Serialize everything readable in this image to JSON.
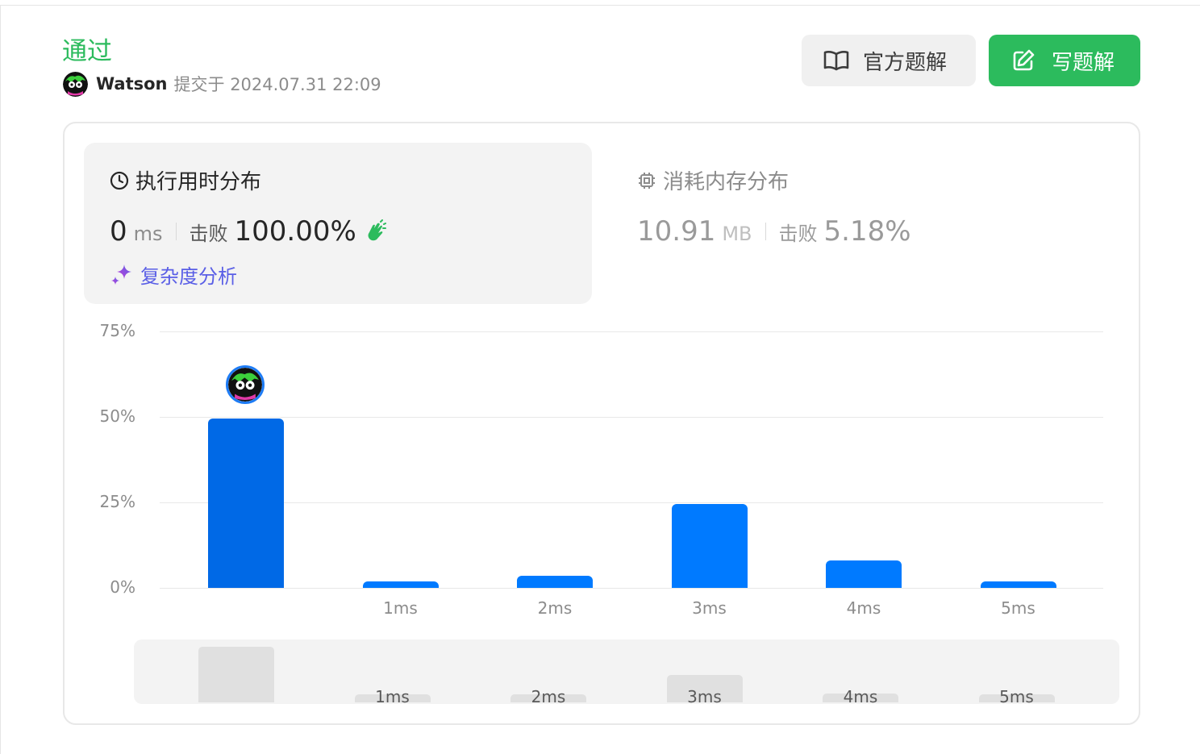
{
  "header": {
    "status": "通过",
    "user": "Watson",
    "submitted_label": "提交于 2024.07.31 22:09",
    "solution_button": "官方题解",
    "write_button": "写题解",
    "icons": [
      "book-icon",
      "edit-icon",
      "avatar"
    ]
  },
  "time_tab": {
    "title": "执行用时分布",
    "value": "0",
    "unit": "ms",
    "beat_label": "击败",
    "beat_value": "100.00%",
    "complexity_link": "复杂度分析"
  },
  "memory_tab": {
    "title": "消耗内存分布",
    "value": "10.91",
    "unit": "MB",
    "beat_label": "击败",
    "beat_value": "5.18%"
  },
  "colors": {
    "accent": "#2cbb5d",
    "bar": "#007aff",
    "selected_bar": "#0069e6",
    "link": "#5a5fe6"
  },
  "chart_data": {
    "type": "bar",
    "categories": [
      "",
      "1ms",
      "2ms",
      "3ms",
      "4ms",
      "5ms"
    ],
    "values": [
      49.5,
      2,
      3.5,
      24.5,
      8,
      2
    ],
    "ylim": [
      0,
      75
    ],
    "yticks": [
      "75%",
      "50%",
      "25%",
      "0%"
    ],
    "selected_index": 0,
    "grid": true
  },
  "minimap": {
    "labels": [
      "",
      "1ms",
      "2ms",
      "3ms",
      "4ms",
      "5ms"
    ]
  }
}
